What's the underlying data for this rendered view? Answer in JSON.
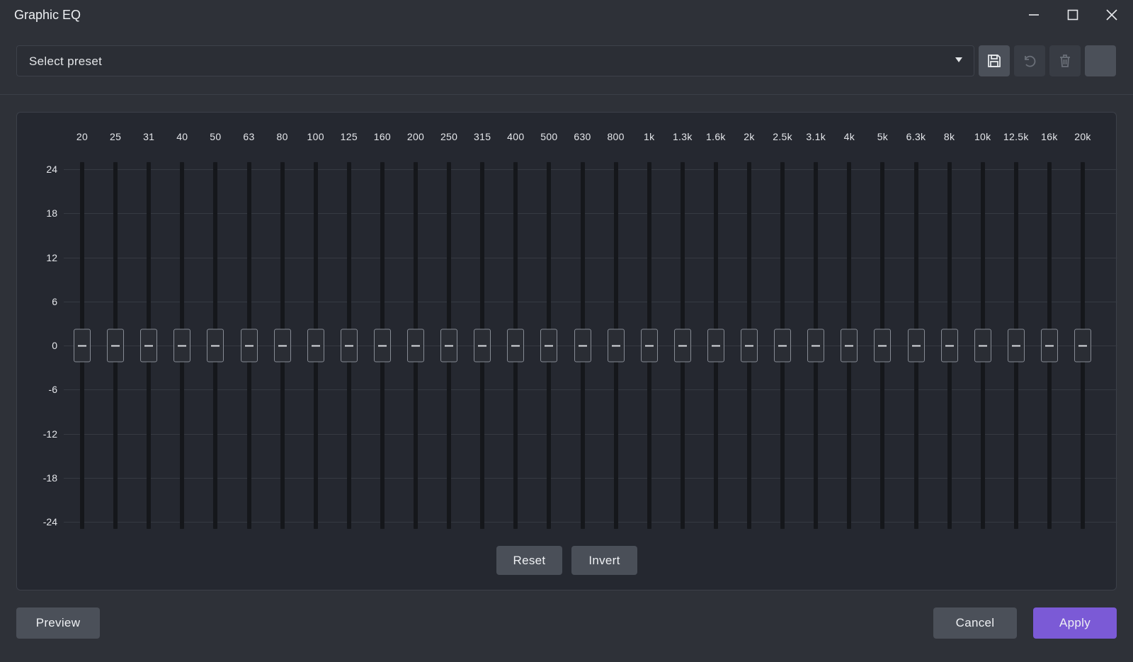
{
  "window": {
    "title": "Graphic EQ",
    "controls": {
      "minimize": "minimize-icon",
      "maximize": "maximize-icon",
      "close": "close-icon"
    }
  },
  "toolbar": {
    "preset_placeholder": "Select preset",
    "buttons": [
      {
        "icon": "save-icon",
        "state": "enabled"
      },
      {
        "icon": "undo-icon",
        "state": "disabled"
      },
      {
        "icon": "trash-icon",
        "state": "disabled"
      },
      {
        "icon": "more-icon",
        "state": "enabled"
      }
    ]
  },
  "eq": {
    "bands": [
      "20",
      "25",
      "31",
      "40",
      "50",
      "63",
      "80",
      "100",
      "125",
      "160",
      "200",
      "250",
      "315",
      "400",
      "500",
      "630",
      "800",
      "1k",
      "1.3k",
      "1.6k",
      "2k",
      "2.5k",
      "3.1k",
      "4k",
      "5k",
      "6.3k",
      "8k",
      "10k",
      "12.5k",
      "16k",
      "20k"
    ],
    "gains_db": [
      0,
      0,
      0,
      0,
      0,
      0,
      0,
      0,
      0,
      0,
      0,
      0,
      0,
      0,
      0,
      0,
      0,
      0,
      0,
      0,
      0,
      0,
      0,
      0,
      0,
      0,
      0,
      0,
      0,
      0,
      0
    ],
    "db_scale": [
      "24",
      "18",
      "12",
      "6",
      "0",
      "-6",
      "-12",
      "-18",
      "-24"
    ],
    "db_range": [
      -24,
      24
    ],
    "reset_label": "Reset",
    "invert_label": "Invert"
  },
  "footer": {
    "preview_label": "Preview",
    "cancel_label": "Cancel",
    "apply_label": "Apply"
  },
  "colors": {
    "background": "#2e3138",
    "panel": "#252830",
    "accent": "#7b5ad6",
    "button": "#4b5059"
  }
}
